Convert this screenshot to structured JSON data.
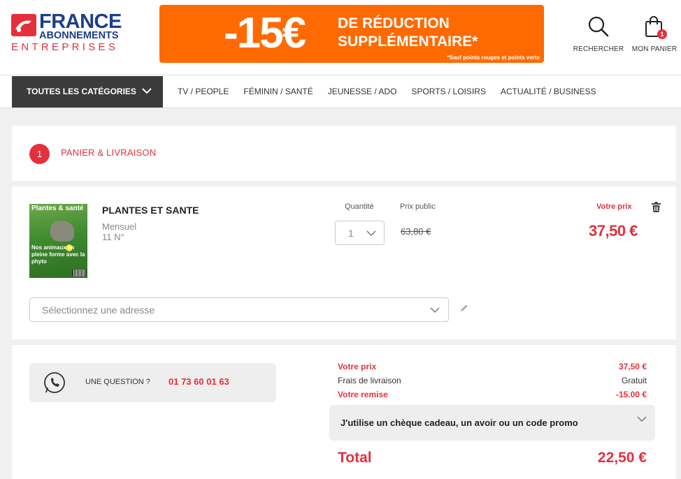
{
  "header": {
    "logo": {
      "line1": "FRANCE",
      "line2": "ABONNEMENTS",
      "line3": "ENTREPRISES"
    },
    "banner": {
      "amount": "-15€",
      "line1": "DE RÉDUCTION",
      "line2": "SUPPLÉMENTAIRE*",
      "note": "*Sauf points rouges et points verts"
    },
    "search_label": "RECHERCHER",
    "cart_label": "MON PANIER",
    "cart_count": "1"
  },
  "nav": {
    "all_categories": "TOUTES LES CATÉGORIES",
    "items": [
      "TV / PEOPLE",
      "FÉMININ / SANTÉ",
      "JEUNESSE / ADO",
      "SPORTS / LOISIRS",
      "ACTUALITÉ / BUSINESS"
    ]
  },
  "step": {
    "number": "1",
    "label": "PANIER & LIVRAISON"
  },
  "item": {
    "cover": {
      "title": "Plantes & santé",
      "text": "Nos animaux en pleine forme avec la phyto"
    },
    "name": "PLANTES ET SANTE",
    "frequency": "Mensuel",
    "issues": "11 N°",
    "qty_label": "Quantité",
    "qty_value": "1",
    "public_price_label": "Prix public",
    "public_price": "63,80 €",
    "your_price_label": "Votre prix",
    "your_price": "37,50 €",
    "address_placeholder": "Sélectionnez une adresse"
  },
  "summary": {
    "question_label": "UNE QUESTION ?",
    "question_phone": "01 73 60 01 63",
    "rows": [
      {
        "label": "Votre prix",
        "value": "37,50 €"
      },
      {
        "label": "Frais de livraison",
        "value": "Gratuit"
      },
      {
        "label": "Votre remise",
        "value": "-15.00 €"
      }
    ],
    "promo_label": "J'utilise un chèque cadeau, un avoir ou un code promo",
    "total_label": "Total",
    "total_value": "22,50 €"
  },
  "colors": {
    "accent": "#e5303c",
    "brand_blue": "#1a3f8c",
    "banner": "#ff6a00",
    "nav_dark": "#3b3b3b"
  }
}
